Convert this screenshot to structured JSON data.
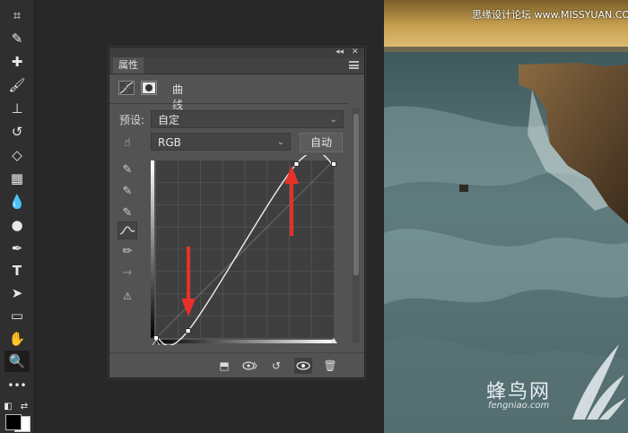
{
  "properties_panel": {
    "tab_label": "属性",
    "collapse_glyph": "◂◂",
    "close_glyph": "✕",
    "adjustment_title": "曲线",
    "preset_label": "预设:",
    "preset_value": "自定",
    "channel_value": "RGB",
    "auto_button": "自动",
    "curve_points": [
      {
        "input": 0,
        "output": 0
      },
      {
        "input": 18,
        "output": 4
      },
      {
        "input": 79,
        "output": 98
      },
      {
        "input": 100,
        "output": 98
      }
    ]
  },
  "watermark": {
    "top_text": "思缘设计论坛 www.MISSYUAN.COM",
    "brand_cn": "蜂鸟网",
    "brand_en": "fengniao.com"
  },
  "colors": {
    "panel_bg": "#535353",
    "arrow_red": "#e8302a",
    "workspace_bg": "#282828"
  }
}
